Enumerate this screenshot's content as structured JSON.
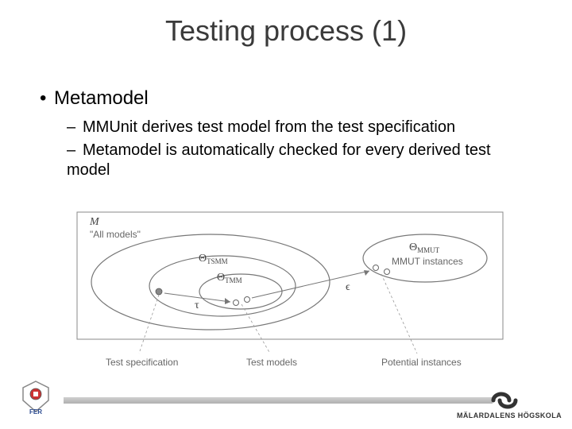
{
  "title": "Testing process (1)",
  "bullet": "Metamodel",
  "subs": [
    "MMUnit derives test model from the test specification",
    "Metamodel is automatically checked for every derived test model"
  ],
  "diagram": {
    "M": "M",
    "all_models": "\"All models\"",
    "theta_tsmm": "Θ",
    "theta_tsmm_sub": "TSMM",
    "theta_tmm": "Θ",
    "theta_tmm_sub": "TMM",
    "theta_mmut": "Θ",
    "theta_mmut_sub": "MMUT",
    "mmut_instances": "MMUT instances",
    "tau": "τ",
    "eps": "ϵ",
    "caption_left": "Test specification",
    "caption_mid": "Test models",
    "caption_right": "Potential instances"
  },
  "footer": {
    "left_org": "FER",
    "right_org": "MÄLARDALENS HÖGSKOLA"
  }
}
